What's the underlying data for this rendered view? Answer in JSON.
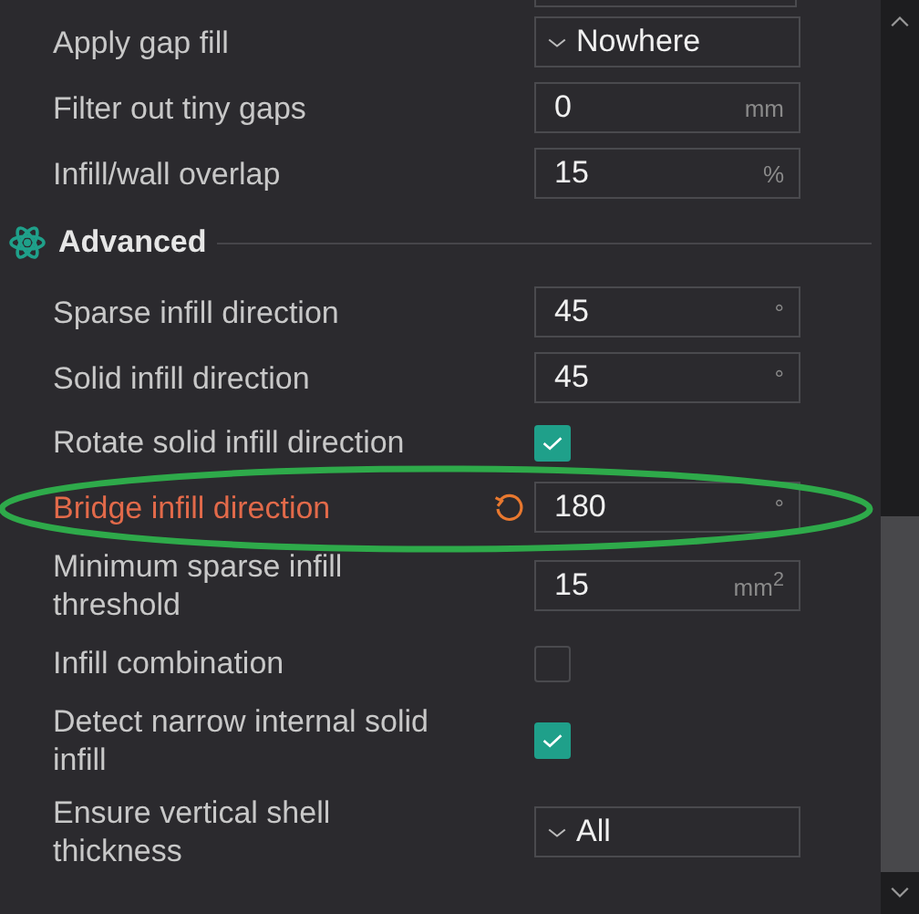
{
  "rows": [
    {
      "kind": "cutoff"
    },
    {
      "kind": "dropdown",
      "label": "Apply gap fill",
      "value": "Nowhere"
    },
    {
      "kind": "number",
      "label": "Filter out tiny gaps",
      "value": "0",
      "unit": "mm"
    },
    {
      "kind": "number",
      "label": "Infill/wall overlap",
      "value": "15",
      "unit": "%"
    },
    {
      "kind": "section",
      "label": "Advanced"
    },
    {
      "kind": "number",
      "label": "Sparse infill direction",
      "value": "45",
      "unit": "°"
    },
    {
      "kind": "number",
      "label": "Solid infill direction",
      "value": "45",
      "unit": "°"
    },
    {
      "kind": "checkbox",
      "label": "Rotate solid infill direction",
      "checked": true
    },
    {
      "kind": "number",
      "label": "Bridge infill direction",
      "value": "180",
      "unit": "°",
      "modified": true,
      "highlighted": true
    },
    {
      "kind": "number",
      "label": "Minimum sparse infill threshold",
      "value": "15",
      "unit": "mm$^{2}$"
    },
    {
      "kind": "checkbox",
      "label": "Infill combination",
      "checked": false
    },
    {
      "kind": "checkbox",
      "label": "Detect narrow internal solid infill",
      "checked": true
    },
    {
      "kind": "dropdown",
      "label": "Ensure vertical shell thickness",
      "value": "All"
    }
  ]
}
